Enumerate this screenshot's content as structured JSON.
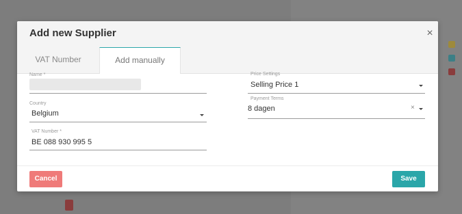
{
  "dialog": {
    "title": "Add new Supplier",
    "close_symbol": "×"
  },
  "tabs": [
    {
      "label": "VAT Number",
      "active": false
    },
    {
      "label": "Add manually",
      "active": true
    }
  ],
  "form": {
    "name": {
      "label": "Name *",
      "value": ""
    },
    "country": {
      "label": "Country",
      "value": "Belgium"
    },
    "vat_number": {
      "label": "VAT Number *",
      "value": "BE 088 930 995 5"
    },
    "price_settings": {
      "label": "Price Settings",
      "value": "Selling Price 1"
    },
    "payment_terms": {
      "label": "Payment Terms",
      "value": "8 dagen",
      "clear_symbol": "×"
    }
  },
  "buttons": {
    "cancel": "Cancel",
    "save": "Save"
  },
  "colors": {
    "accent": "#2aa6a9",
    "cancel": "#ef7a79"
  }
}
